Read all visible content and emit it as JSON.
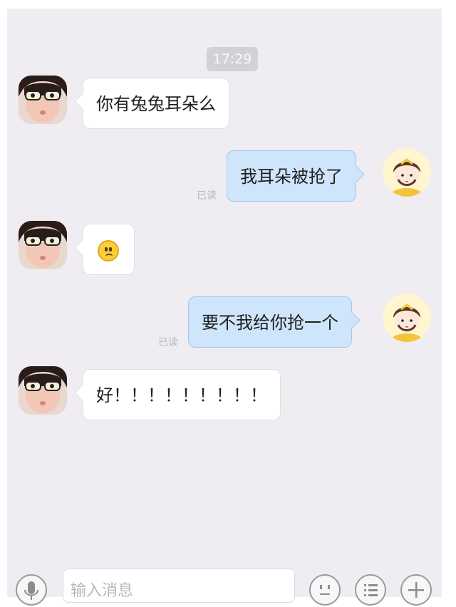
{
  "timestamp": "17:29",
  "messages": [
    {
      "side": "in",
      "text": "你有兔兔耳朵么"
    },
    {
      "side": "out",
      "text": "我耳朵被抢了",
      "status": "已读"
    },
    {
      "side": "in",
      "emoji": "frown-emoji"
    },
    {
      "side": "out",
      "text": "要不我给你抢一个",
      "status": "已读"
    },
    {
      "side": "in",
      "text": "好！！！！！！！！！"
    }
  ],
  "input": {
    "placeholder": "输入消息"
  },
  "icons": {
    "voice": "microphone-icon",
    "emoji": "smiley-face-icon",
    "menu": "list-icon",
    "add": "plus-icon"
  },
  "colors": {
    "chat_bg": "#efedf1",
    "incoming_bubble": "#ffffff",
    "outgoing_bubble": "#cfe5fb",
    "outgoing_border": "#a6c6ea"
  }
}
